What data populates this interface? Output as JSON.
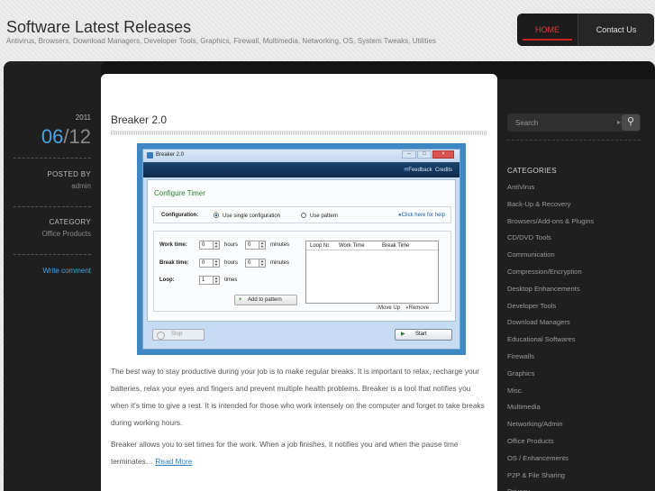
{
  "header": {
    "site_title": "Software Latest Releases",
    "tagline": "Antivirus, Browsers, Download Managers, Developer Tools, Graphics, Firewall, Multimedia, Networking, OS, System Tweaks, Utilities"
  },
  "nav": {
    "home": "HOME",
    "contact": "Contact Us"
  },
  "post_meta": {
    "year": "2011",
    "month": "06",
    "separator": "/",
    "day": "12",
    "posted_by_label": "POSTED BY",
    "author": "admin",
    "category_label": "CATEGORY",
    "category": "Office Products",
    "comment_link": "Write comment"
  },
  "post": {
    "title": "Breaker 2.0",
    "paragraph1": "The best way to stay productive during your job is to make regular breaks. It is important to relax, recharge your batteries, relax your eyes and fingers and prevent multiple health problems. Breaker is a tool that notifies you when it's time to give a rest. It is intended for those who work intensely on the computer and forget to take breaks during working hours.",
    "paragraph2": "Breaker allows you to set times for the work. When a job finishes, it notifies you and when the pause time terminates…",
    "read_more": "Read More"
  },
  "screenshot": {
    "window_title": "Breaker 2.0",
    "feedback": "Feedback",
    "credits": "Credits",
    "configure_title": "Configure Timer",
    "configuration_label": "Configuration:",
    "option_single": "Use single configuration",
    "option_pattern": "Use pattern",
    "help_link": "Click here for help",
    "work_time_label": "Work time:",
    "break_time_label": "Break time:",
    "loop_label": "Loop:",
    "work_hours": "0",
    "work_minutes": "0",
    "break_hours": "0",
    "break_minutes": "0",
    "loop_times": "1",
    "hours_unit": "hours",
    "minutes_unit": "minutes",
    "times_unit": "times",
    "add_pattern": "Add to pattern",
    "col_loop": "Loop Nr.",
    "col_work": "Work Time",
    "col_break": "Break Time",
    "move_up": "Move Up",
    "remove": "Remove",
    "stop": "Stop",
    "start": "Start"
  },
  "sidebar": {
    "search_placeholder": "Search",
    "categories_title": "CATEGORIES",
    "categories": [
      "AntiVirus",
      "Back-Up & Recovery",
      "Browsers/Add-ons & Plugins",
      "CD/DVD Tools",
      "Communication",
      "Compression/Encryption",
      "Desktop Enhancements",
      "Developer Tools",
      "Download Managers",
      "Educational Softwares",
      "Firewalls",
      "Graphics",
      "Misc.",
      "Multimedia",
      "Networking/Admin",
      "Office Products",
      "OS / Enhancements",
      "P2P & File Sharing",
      "Privacy"
    ]
  }
}
